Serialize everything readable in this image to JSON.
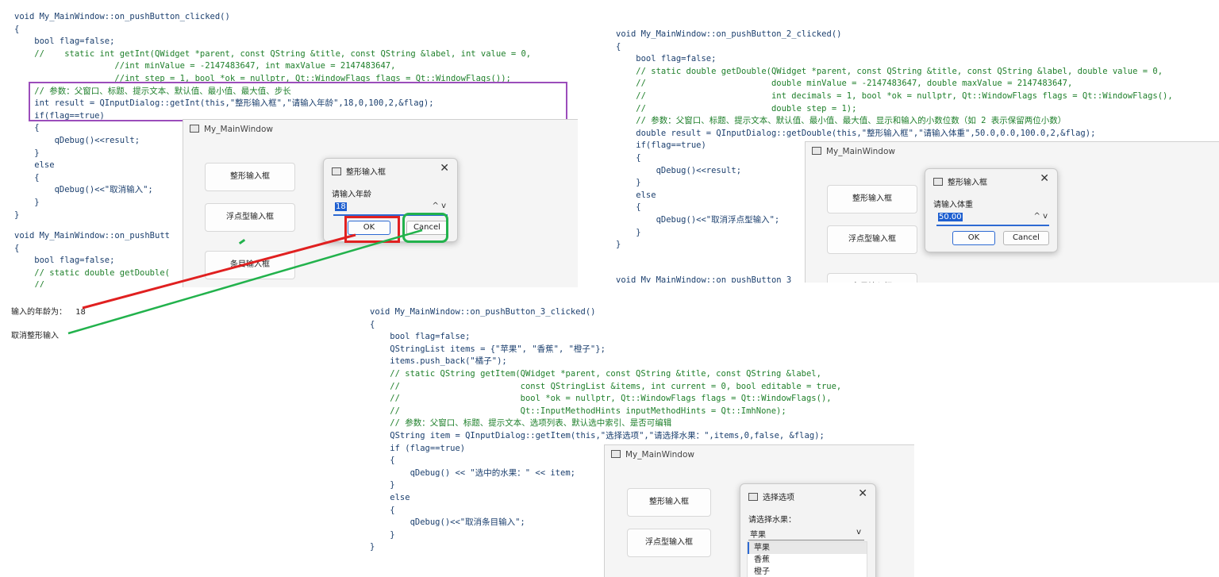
{
  "panel1": {
    "lines": [
      "void My_MainWindow::on_pushButton_clicked()",
      "{",
      "    bool flag=false;",
      "    //    static int getInt(QWidget *parent, const QString &title, const QString &label, int value = 0,",
      "                    //int minValue = -2147483647, int maxValue = 2147483647,",
      "                    //int step = 1, bool *ok = nullptr, Qt::WindowFlags flags = Qt::WindowFlags());",
      "    // 参数：父窗口、标题、提示文本、默认值、最小值、最大值、步长",
      "    int result = QInputDialog::getInt(this,\"整形输入框\",\"请输入年龄\",18,0,100,2,&flag);",
      "    if(flag==true)",
      "    {",
      "        qDebug()<<result;",
      "    }",
      "    else",
      "    {",
      "        qDebug()<<\"取消输入\";",
      "    }",
      "}",
      "void My_MainWindow::on_pushButt",
      "{",
      "    bool flag=false;",
      "    // static double getDouble(",
      "    //"
    ]
  },
  "panel2": {
    "lines": [
      "void My_MainWindow::on_pushButton_2_clicked()",
      "{",
      "    bool flag=false;",
      "    // static double getDouble(QWidget *parent, const QString &title, const QString &label, double value = 0,",
      "    //                         double minValue = -2147483647, double maxValue = 2147483647,",
      "    //                         int decimals = 1, bool *ok = nullptr, Qt::WindowFlags flags = Qt::WindowFlags(),",
      "    //                         double step = 1);",
      "    // 参数：父窗口、标题、提示文本、默认值、最小值、最大值、显示和输入的小数位数（如 2 表示保留两位小数）",
      "    double result = QInputDialog::getDouble(this,\"整形输入框\",\"请输入体重\",50.0,0.0,100.0,2,&flag);",
      "    if(flag==true)",
      "    {",
      "        qDebug()<<result;",
      "    }",
      "    else",
      "    {",
      "        qDebug()<<\"取消浮点型输入\";",
      "    }",
      "}",
      "",
      "void My_MainWindow::on_pushButton_3"
    ]
  },
  "panel3": {
    "lines": [
      "void My_MainWindow::on_pushButton_3_clicked()",
      "{",
      "    bool flag=false;",
      "    QStringList items = {\"苹果\", \"香蕉\", \"橙子\"};",
      "    items.push_back(\"橘子\");",
      "    // static QString getItem(QWidget *parent, const QString &title, const QString &label,",
      "    //                        const QStringList &items, int current = 0, bool editable = true,",
      "    //                        bool *ok = nullptr, Qt::WindowFlags flags = Qt::WindowFlags(),",
      "    //                        Qt::InputMethodHints inputMethodHints = Qt::ImhNone);",
      "    // 参数：父窗口、标题、提示文本、选项列表、默认选中索引、是否可编辑",
      "    QString item = QInputDialog::getItem(this,\"选择选项\",\"请选择水果：\",items,0,false, &flag);",
      "    if (flag==true)",
      "    {",
      "        qDebug() << \"选中的水果：\" << item;",
      "    }",
      "    else",
      "    {",
      "        qDebug()<<\"取消条目输入\";",
      "    }",
      "}"
    ]
  },
  "window": {
    "title": "My_MainWindow",
    "btn_int": "整形输入框",
    "btn_double": "浮点型输入框",
    "btn_item": "条目输入框"
  },
  "dialog_int": {
    "title": "整形输入框",
    "label": "请输入年龄",
    "value": "18",
    "ok": "OK",
    "cancel": "Cancel",
    "close": "✕",
    "arrows": "^ v"
  },
  "dialog_double": {
    "title": "整形输入框",
    "label": "请输入体重",
    "value": "50.00",
    "ok": "OK",
    "cancel": "Cancel",
    "close": "✕",
    "arrows": "^ v"
  },
  "dialog_item": {
    "title": "选择选项",
    "label": "请选择水果：",
    "selected": "苹果",
    "options": [
      "苹果",
      "香蕉",
      "橙子"
    ],
    "close": "✕",
    "chevron": "v"
  },
  "output": {
    "line1_label": "输入的年龄为：",
    "line1_value": "18",
    "line2": "取消整形输入"
  },
  "colors": {
    "highlight_purple": "#9b4dbb",
    "ok_box_red": "#e02020",
    "cancel_box_green": "#22b24c"
  }
}
